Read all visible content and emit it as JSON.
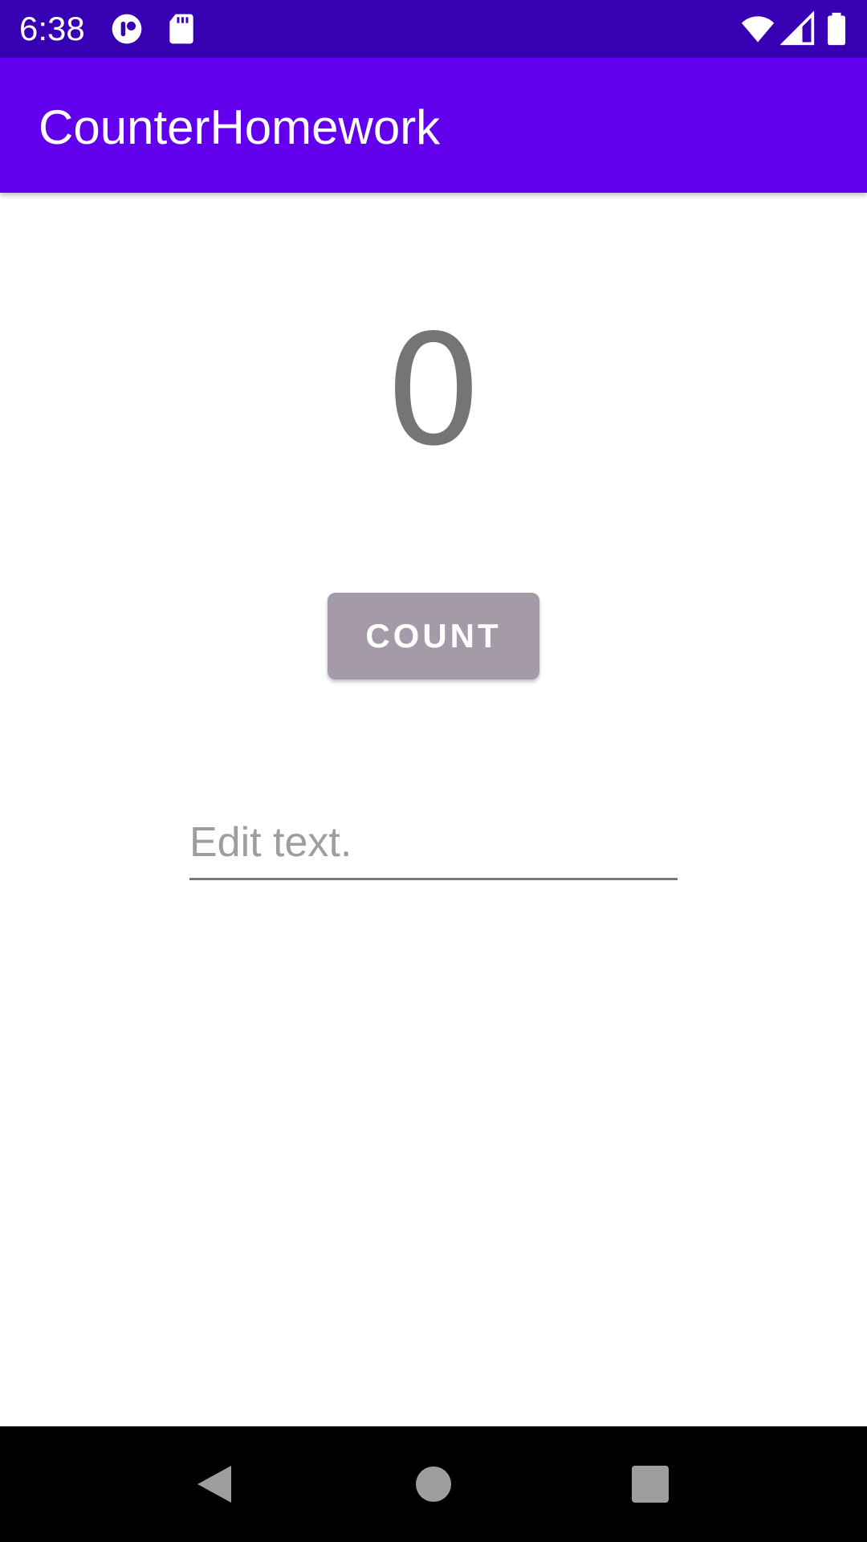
{
  "status_bar": {
    "time": "6:38",
    "left_icons": [
      "notification-app-icon",
      "sd-card-icon"
    ],
    "right_icons": [
      "wifi-icon",
      "cell-signal-icon",
      "battery-icon"
    ]
  },
  "app_bar": {
    "title": "CounterHomework"
  },
  "main": {
    "count_value": "0",
    "count_button_label": "COUNT",
    "edit_placeholder": "Edit text.",
    "edit_value": ""
  },
  "nav_bar": {
    "buttons": [
      "back-icon",
      "home-icon",
      "recents-icon"
    ]
  },
  "colors": {
    "status_bar": "#3700b3",
    "app_bar": "#6200ee",
    "button": "#a59ba8",
    "count_text": "#757575"
  }
}
